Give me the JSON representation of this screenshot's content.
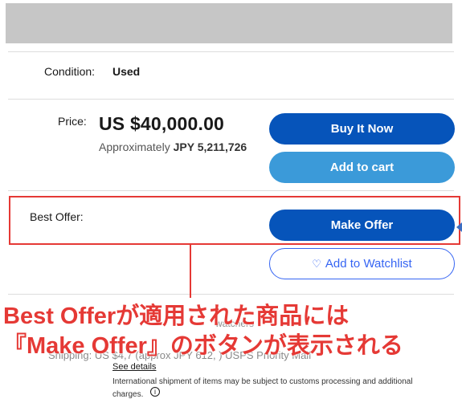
{
  "condition": {
    "label": "Condition:",
    "value": "Used"
  },
  "price": {
    "label": "Price:",
    "main": "US $40,000.00",
    "approx_prefix": "Approximately",
    "approx_value": "JPY 5,211,726"
  },
  "buttons": {
    "buy_now": "Buy It Now",
    "add_to_cart": "Add to cart",
    "make_offer": "Make Offer",
    "watchlist": "Add to Watchlist"
  },
  "best_offer": {
    "label": "Best Offer:"
  },
  "annotation": {
    "line1": "Best Offerが適用された商品には",
    "line2": "『Make Offer』のボタンが表示される"
  },
  "background": {
    "watchers": "watchers",
    "shipping": "Shipping:  US $4,7  (approx JPY 612,  ) USPS Priority Mail",
    "see_details": "See details",
    "intl_note": "International shipment of items may be subject to customs processing and additional",
    "intl_note2": "charges."
  },
  "icons": {
    "heart": "heart-icon",
    "info": "info-icon"
  },
  "colors": {
    "primary": "#0654ba",
    "secondary": "#3b9ad9",
    "link": "#3665f3",
    "annotation": "#e53935"
  }
}
